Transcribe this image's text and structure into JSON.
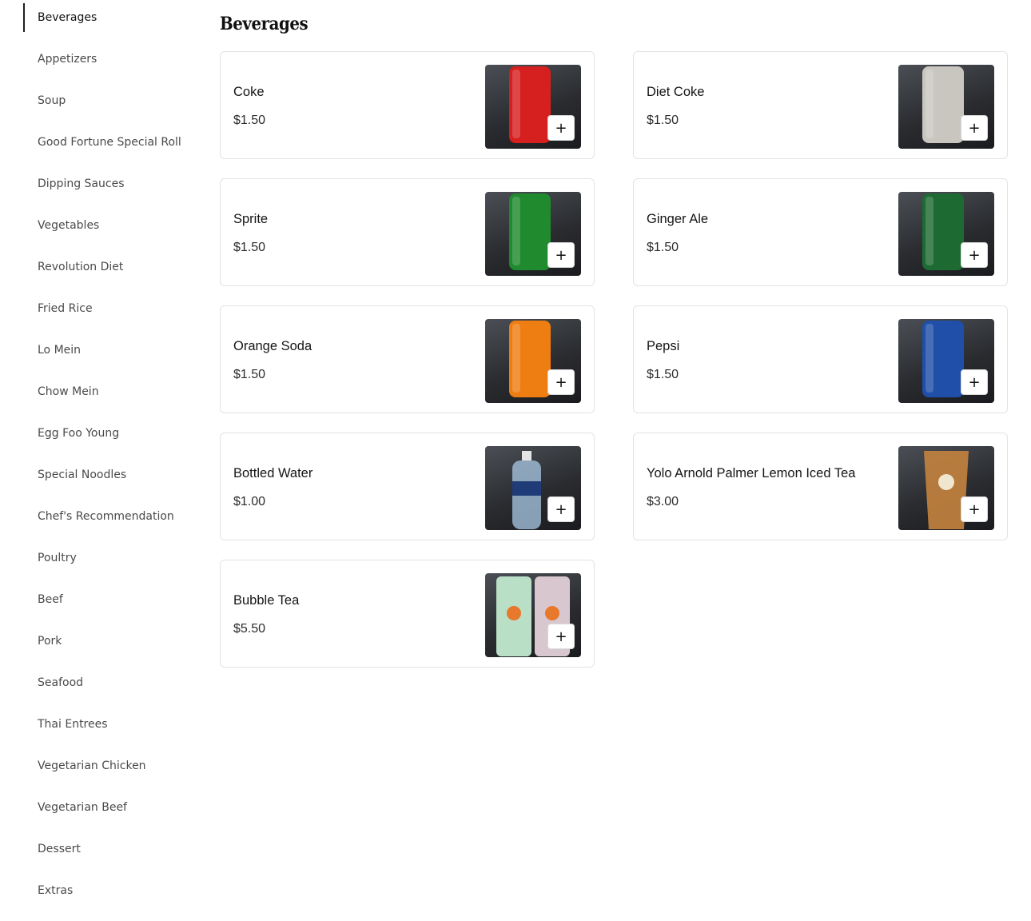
{
  "sidebar": {
    "items": [
      {
        "label": "Beverages",
        "active": true
      },
      {
        "label": "Appetizers"
      },
      {
        "label": "Soup"
      },
      {
        "label": "Good Fortune Special Roll"
      },
      {
        "label": "Dipping Sauces"
      },
      {
        "label": "Vegetables"
      },
      {
        "label": "Revolution Diet"
      },
      {
        "label": "Fried Rice"
      },
      {
        "label": "Lo Mein"
      },
      {
        "label": "Chow Mein"
      },
      {
        "label": "Egg Foo Young"
      },
      {
        "label": "Special Noodles"
      },
      {
        "label": "Chef's Recommendation"
      },
      {
        "label": "Poultry"
      },
      {
        "label": "Beef"
      },
      {
        "label": "Pork"
      },
      {
        "label": "Seafood"
      },
      {
        "label": "Thai Entrees"
      },
      {
        "label": "Vegetarian Chicken"
      },
      {
        "label": "Vegetarian Beef"
      },
      {
        "label": "Dessert"
      },
      {
        "label": "Extras"
      }
    ]
  },
  "main": {
    "title": "Beverages",
    "add_symbol": "+",
    "items": [
      {
        "name": "Coke",
        "price": "$1.50",
        "image": "coke-can-photo",
        "color": "#d61f1f"
      },
      {
        "name": "Diet Coke",
        "price": "$1.50",
        "image": "diet-coke-can-photo",
        "color": "#c9c6c0"
      },
      {
        "name": "Sprite",
        "price": "$1.50",
        "image": "sprite-can-photo",
        "color": "#1f8a2e"
      },
      {
        "name": "Ginger Ale",
        "price": "$1.50",
        "image": "ginger-ale-can-photo",
        "color": "#1d6b33"
      },
      {
        "name": "Orange Soda",
        "price": "$1.50",
        "image": "orange-soda-can-photo",
        "color": "#ee7d12"
      },
      {
        "name": "Pepsi",
        "price": "$1.50",
        "image": "pepsi-can-photo",
        "color": "#1f4fa8"
      },
      {
        "name": "Bottled Water",
        "price": "$1.00",
        "image": "water-bottle-photo",
        "color": "#a9c9e6"
      },
      {
        "name": "Yolo Arnold Palmer Lemon Iced Tea",
        "price": "$3.00",
        "image": "iced-tea-cup-photo",
        "color": "#c4833e"
      },
      {
        "name": "Bubble Tea",
        "price": "$5.50",
        "image": "bubble-tea-cups-photo",
        "color": "#b9e0c6"
      }
    ]
  }
}
